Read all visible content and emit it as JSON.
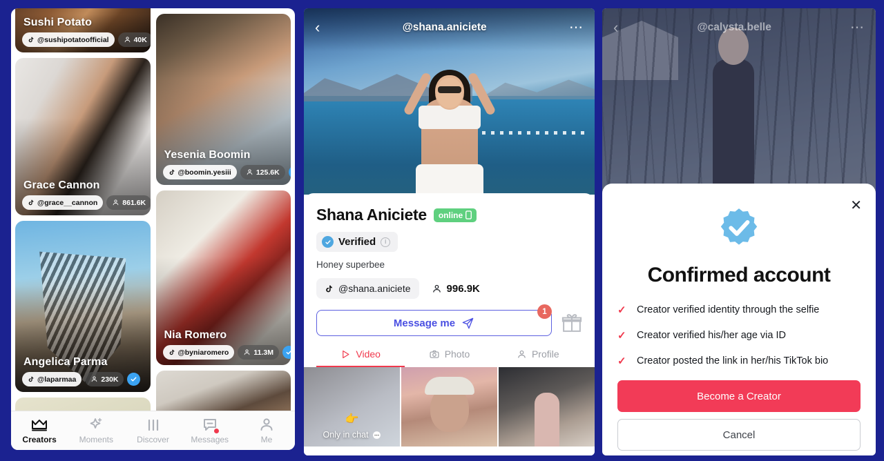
{
  "theme": {
    "page_background": "#1b2290",
    "accent_red": "#f0394d",
    "accent_blue": "#4a4fe2",
    "verified_blue": "#3ba3f2",
    "online_green": "#5fd07f",
    "primary_button": "#f23b57"
  },
  "creators_screen": {
    "cards": [
      {
        "name": "Sushi Potato",
        "handle": "@sushipotatoofficial",
        "fans": "40K",
        "verified": true
      },
      {
        "name": "Grace Cannon",
        "handle": "@grace__cannon",
        "fans": "861.6K",
        "verified": true
      },
      {
        "name": "Yesenia Boomin",
        "handle": "@boomin.yesiii",
        "fans": "125.6K",
        "verified": true
      },
      {
        "name": "Nia Romero",
        "handle": "@byniaromero",
        "fans": "11.3M",
        "verified": true
      },
      {
        "name": "Angelica Parma",
        "handle": "@laparmaa",
        "fans": "230K",
        "verified": true
      }
    ],
    "bottom_nav": [
      {
        "label": "Creators",
        "icon": "crown-icon",
        "active": true,
        "dot": false
      },
      {
        "label": "Moments",
        "icon": "sparkle-icon",
        "active": false,
        "dot": false
      },
      {
        "label": "Discover",
        "icon": "bars-icon",
        "active": false,
        "dot": false
      },
      {
        "label": "Messages",
        "icon": "message-icon",
        "active": false,
        "dot": true
      },
      {
        "label": "Me",
        "icon": "person-icon",
        "active": false,
        "dot": false
      }
    ]
  },
  "profile_screen": {
    "header": {
      "title": "@shana.aniciete",
      "back_icon": "chevron-left-icon",
      "more_icon": "more-dots-icon"
    },
    "display_name": "Shana Aniciete",
    "online_label": "online",
    "verified_label": "Verified",
    "bio": "Honey superbee",
    "handle": "@shana.aniciete",
    "fans": "996.9K",
    "message_button": "Message me",
    "message_badge": "1",
    "gift_icon": "gift-icon",
    "tabs": [
      {
        "label": "Video",
        "icon": "play-icon",
        "active": true
      },
      {
        "label": "Photo",
        "icon": "camera-icon",
        "active": false
      },
      {
        "label": "Profile",
        "icon": "person-icon",
        "active": false
      }
    ],
    "thumbnails": [
      {
        "overlay": "Only in chat",
        "locked": true
      },
      {
        "overlay": "",
        "locked": false
      },
      {
        "overlay": "",
        "locked": false
      }
    ]
  },
  "modal_screen": {
    "header": {
      "title": "@calysta.belle",
      "back_icon": "chevron-left-icon",
      "more_icon": "more-dots-icon"
    },
    "modal": {
      "close_icon": "close-icon",
      "badge_icon": "verified-badge-icon",
      "title": "Confirmed account",
      "checklist": [
        "Creator verified identity through the selfie",
        "Creator verified his/her age via ID",
        "Creator posted the link in her/his TikTok bio"
      ],
      "primary_button": "Become a Creator",
      "secondary_button": "Cancel"
    }
  }
}
